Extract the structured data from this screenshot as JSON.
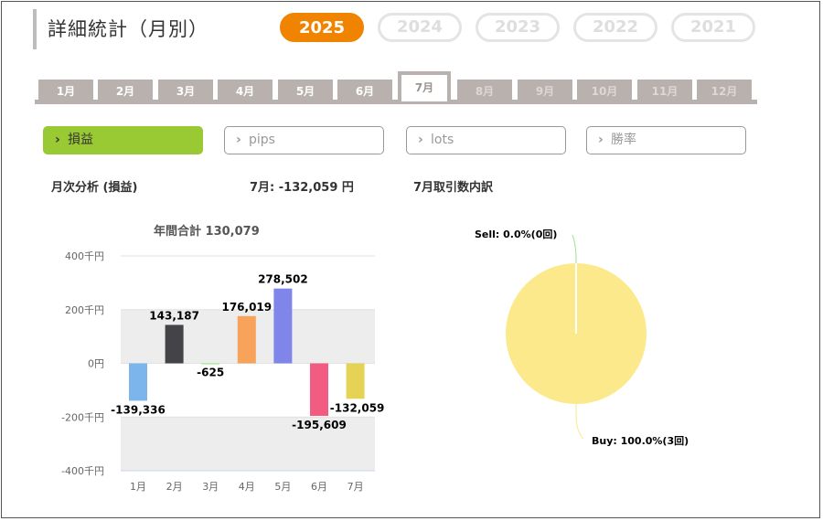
{
  "page": {
    "title": "詳細統計（月別）"
  },
  "years": [
    {
      "label": "2025",
      "active": true
    },
    {
      "label": "2024",
      "active": false
    },
    {
      "label": "2023",
      "active": false
    },
    {
      "label": "2022",
      "active": false
    },
    {
      "label": "2021",
      "active": false
    }
  ],
  "months": [
    {
      "label": "1月",
      "state": "normal"
    },
    {
      "label": "2月",
      "state": "normal"
    },
    {
      "label": "3月",
      "state": "normal"
    },
    {
      "label": "4月",
      "state": "normal"
    },
    {
      "label": "5月",
      "state": "normal"
    },
    {
      "label": "6月",
      "state": "normal"
    },
    {
      "label": "7月",
      "state": "active"
    },
    {
      "label": "8月",
      "state": "disabled"
    },
    {
      "label": "9月",
      "state": "disabled"
    },
    {
      "label": "10月",
      "state": "disabled"
    },
    {
      "label": "11月",
      "state": "disabled"
    },
    {
      "label": "12月",
      "state": "disabled"
    }
  ],
  "metrics": [
    {
      "label": "損益",
      "active": true
    },
    {
      "label": "pips",
      "active": false
    },
    {
      "label": "lots",
      "active": false
    },
    {
      "label": "勝率",
      "active": false
    }
  ],
  "summary": {
    "analysis_label": "月次分析 (損益)",
    "month_result": "7月:  -132,059 円",
    "breakdown_label": "7月取引数内訳"
  },
  "colors": {
    "accent": "#f08300",
    "active_metric": "#99c933",
    "tab": "#b8b1ad",
    "pie_buy": "#fbe98b",
    "pie_sell_leader": "#9be38a"
  },
  "chart_data": [
    {
      "type": "bar",
      "title": "年間合計 130,079",
      "categories": [
        "1月",
        "2月",
        "3月",
        "4月",
        "5月",
        "6月",
        "7月"
      ],
      "values": [
        -139336,
        143187,
        -625,
        176019,
        278502,
        -195609,
        -132059
      ],
      "value_labels": [
        "-139,336",
        "143,187",
        "-625",
        "176,019",
        "278,502",
        "-195,609",
        "-132,059"
      ],
      "bar_colors": [
        "#7cb5ec",
        "#434348",
        "#90ed7d",
        "#f7a35c",
        "#8085e9",
        "#f15c80",
        "#e4d354"
      ],
      "yticks": [
        400000,
        200000,
        0,
        -200000,
        -400000
      ],
      "ytick_labels": [
        "400千円",
        "200千円",
        "0円",
        "-200千円",
        "-400千円"
      ],
      "ylim": [
        -400000,
        400000
      ],
      "grid": true,
      "xlabel": "",
      "ylabel": ""
    },
    {
      "type": "pie",
      "slices": [
        {
          "name": "Sell",
          "value": 0,
          "label": "Sell: 0.0%(0回)"
        },
        {
          "name": "Buy",
          "value": 3,
          "label": "Buy: 100.0%(3回)"
        }
      ]
    }
  ]
}
